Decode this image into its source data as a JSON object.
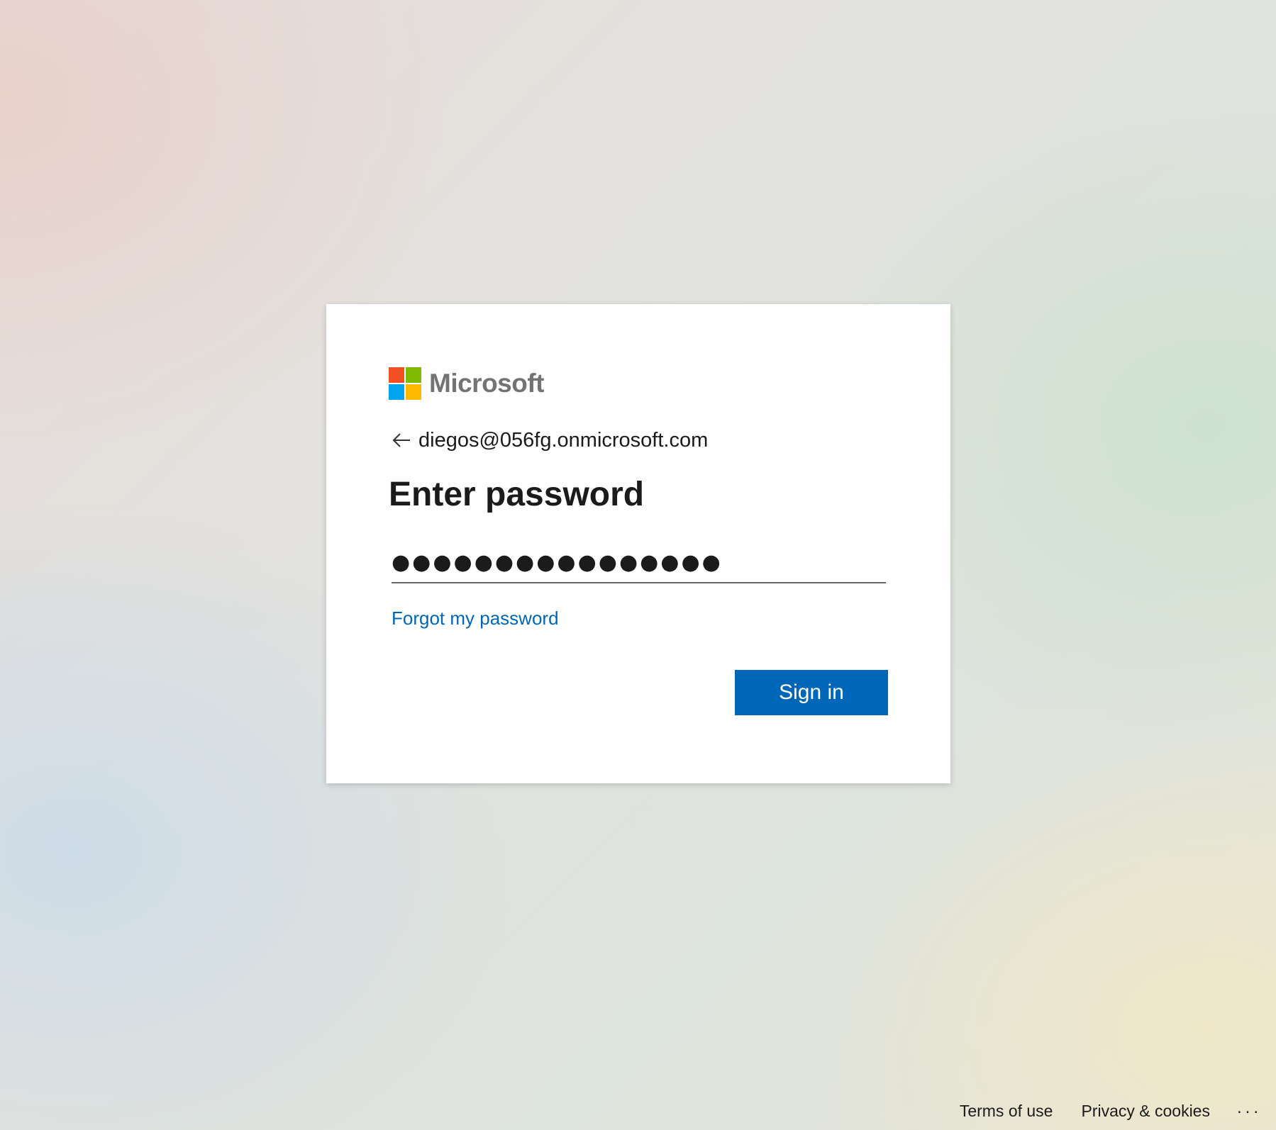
{
  "brand": {
    "name": "Microsoft",
    "logo_colors": [
      "#f25022",
      "#7fba00",
      "#00a4ef",
      "#ffb900"
    ]
  },
  "identity": {
    "email": "diegos@056fg.onmicrosoft.com",
    "back_icon": "arrow-left-icon"
  },
  "heading": "Enter password",
  "password_field": {
    "value": "●●●●●●●●●●●●●●●●",
    "type": "password"
  },
  "forgot_link": "Forgot my password",
  "signin_button": "Sign in",
  "colors": {
    "accent": "#0067b8",
    "text": "#1b1b1b",
    "brand_text": "#737373"
  },
  "footer": {
    "terms": "Terms of use",
    "privacy": "Privacy & cookies",
    "more": "..."
  }
}
